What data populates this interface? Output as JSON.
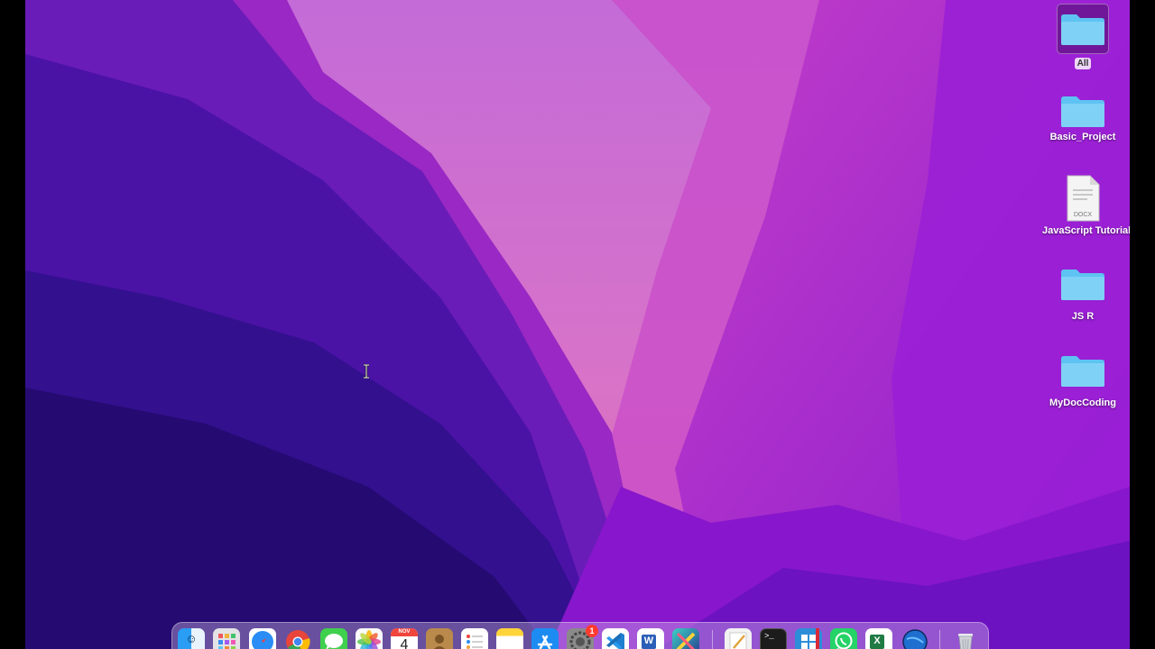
{
  "desktop": {
    "icons": [
      {
        "label": "All",
        "type": "folder"
      },
      {
        "label": "Basic_Project",
        "type": "folder"
      },
      {
        "label": "JavaScript Tutorial",
        "type": "document",
        "file_tag": "DOCX"
      },
      {
        "label": "JS R",
        "type": "folder"
      },
      {
        "label": "MyDocCoding",
        "type": "folder"
      }
    ],
    "cursor": "text-cursor-icon"
  },
  "dock": {
    "apps": [
      {
        "name": "finder-icon",
        "color": "#1e9bf0"
      },
      {
        "name": "launchpad-icon",
        "color": "#d9d9d9"
      },
      {
        "name": "safari-icon",
        "color": "#2a8df5"
      },
      {
        "name": "chrome-icon",
        "color": "#e8453c"
      },
      {
        "name": "messages-icon",
        "color": "#3fd04d"
      },
      {
        "name": "photos-icon",
        "color": "#f7f7f7"
      },
      {
        "name": "calendar-icon",
        "color": "#ffffff",
        "month": "NOV",
        "day": "4"
      },
      {
        "name": "contacts-icon",
        "color": "#b98a4c"
      },
      {
        "name": "reminders-icon",
        "color": "#ffffff"
      },
      {
        "name": "notes-icon",
        "color": "#ffd43b"
      },
      {
        "name": "app-store-icon",
        "color": "#1c8cf2"
      },
      {
        "name": "system-settings-icon",
        "color": "#8a8a8a",
        "badge": "1"
      },
      {
        "name": "vscode-icon",
        "color": "#1f7fd0"
      },
      {
        "name": "word-icon",
        "color": "#2b5fb8",
        "glyph": "W"
      },
      {
        "name": "game-icon",
        "color": "#3ad1c4"
      },
      {
        "name": "textedit-icon",
        "color": "#f2f2f2"
      },
      {
        "name": "terminal-icon",
        "color": "#1c1c1c",
        "glyph": ">_"
      },
      {
        "name": "windows-app-icon",
        "color": "#2c8ed8"
      },
      {
        "name": "whatsapp-icon",
        "color": "#25d366"
      },
      {
        "name": "excel-icon",
        "color": "#1f7a44",
        "glyph": "X"
      },
      {
        "name": "browser-icon",
        "color": "#1f6fd0"
      },
      {
        "name": "trash-icon",
        "color": "#cfd3d8"
      }
    ]
  }
}
